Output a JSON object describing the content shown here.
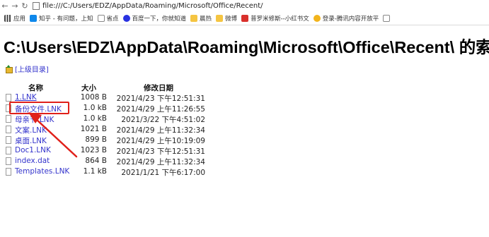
{
  "address_bar": {
    "url": "file:///C:/Users/EDZ/AppData/Roaming/Microsoft/Office/Recent/"
  },
  "bookmarks": [
    {
      "label": "应用",
      "icon": "apps-icon"
    },
    {
      "label": "知乎 - 有问题，上知",
      "icon": "zhihu-icon"
    },
    {
      "label": "省点",
      "icon": "page-icon"
    },
    {
      "label": "百度一下，你就知道",
      "icon": "baidu-icon"
    },
    {
      "label": "晨热",
      "icon": "folder-icon"
    },
    {
      "label": "微博",
      "icon": "folder-icon"
    },
    {
      "label": "普罗米修斯--小红书文",
      "icon": "red-app-icon"
    },
    {
      "label": "登录-腾讯内容开放平",
      "icon": "yellow-app-icon"
    }
  ],
  "page": {
    "title": "C:\\Users\\EDZ\\AppData\\Roaming\\Microsoft\\Office\\Recent\\ 的索引",
    "parent_link": "[上级目录]"
  },
  "table": {
    "headers": {
      "name": "名称",
      "size": "大小",
      "modified": "修改日期"
    },
    "rows": [
      {
        "name": "1.LNK",
        "size": "1008 B",
        "date": "2021/4/23 下午12:51:31"
      },
      {
        "name": "备份文件.LNK",
        "size": "1.0 kB",
        "date": "2021/4/29 上午11:26:55"
      },
      {
        "name": "母亲节.LNK",
        "size": "1.0 kB",
        "date": "2021/3/22 下午4:51:02"
      },
      {
        "name": "文案.LNK",
        "size": "1021 B",
        "date": "2021/4/29 上午11:32:34"
      },
      {
        "name": "桌面.LNK",
        "size": "899 B",
        "date": "2021/4/29 上午10:19:09"
      },
      {
        "name": "Doc1.LNK",
        "size": "1023 B",
        "date": "2021/4/23 下午12:51:31"
      },
      {
        "name": "index.dat",
        "size": "864 B",
        "date": "2021/4/29 上午11:32:34"
      },
      {
        "name": "Templates.LNK",
        "size": "1.1 kB",
        "date": "2021/1/21 下午6:17:00"
      }
    ]
  },
  "colors": {
    "link": "#3434cc",
    "annotation": "#e0201a"
  }
}
